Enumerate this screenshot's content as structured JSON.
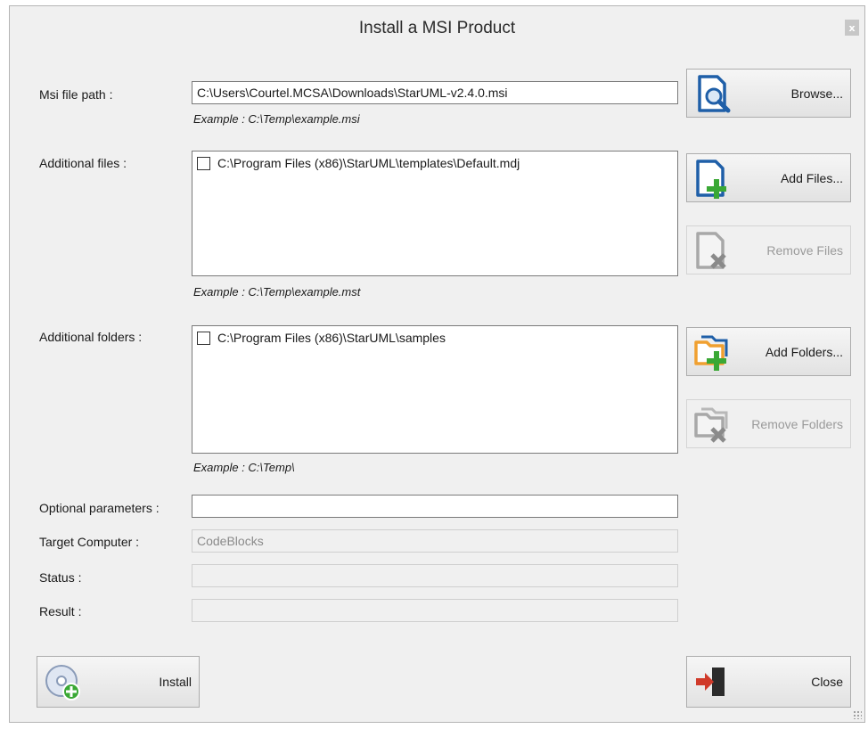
{
  "window": {
    "title": "Install a MSI Product",
    "close_glyph": "x"
  },
  "msi": {
    "label": "Msi file path :",
    "value": "C:\\Users\\Courtel.MCSA\\Downloads\\StarUML-v2.4.0.msi",
    "example": "Example : C:\\Temp\\example.msi",
    "browse_label": "Browse..."
  },
  "files": {
    "label": "Additional files :",
    "items": [
      "C:\\Program Files (x86)\\StarUML\\templates\\Default.mdj"
    ],
    "example": "Example : C:\\Temp\\example.mst",
    "add_label": "Add Files...",
    "remove_label": "Remove Files"
  },
  "folders": {
    "label": "Additional folders :",
    "items": [
      "C:\\Program Files (x86)\\StarUML\\samples"
    ],
    "example": "Example : C:\\Temp\\",
    "add_label": "Add Folders...",
    "remove_label": "Remove Folders"
  },
  "optional": {
    "label": "Optional parameters :",
    "value": ""
  },
  "target": {
    "label": "Target Computer :",
    "value": "CodeBlocks"
  },
  "status": {
    "label": "Status :",
    "value": ""
  },
  "result": {
    "label": "Result :",
    "value": ""
  },
  "actions": {
    "install_label": "Install",
    "close_label": "Close"
  },
  "icons": {
    "browse": "search-document-icon",
    "add_files": "add-file-icon",
    "remove_files": "remove-file-icon",
    "add_folders": "add-folder-icon",
    "remove_folders": "remove-folder-icon",
    "install": "install-disc-icon",
    "close": "exit-door-icon"
  },
  "colors": {
    "accent_blue": "#1f5fa8",
    "add_green": "#3aa835",
    "folder_orange": "#f0a030",
    "exit_red": "#d03a2a"
  }
}
